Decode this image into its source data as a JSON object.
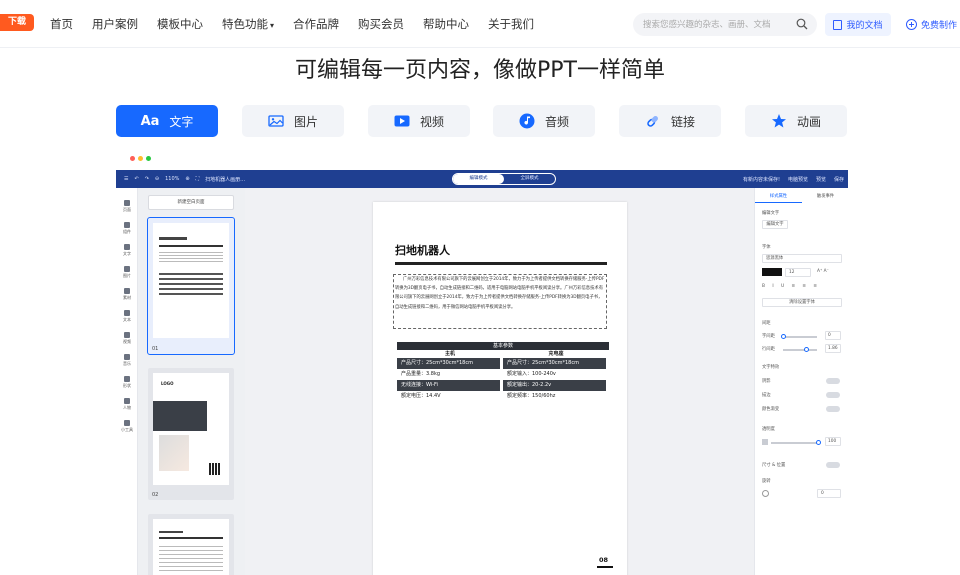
{
  "nav": {
    "app_badge": "下载App",
    "links": [
      "首页",
      "用户案例",
      "模板中心",
      "特色功能",
      "合作品牌",
      "购买会员",
      "帮助中心",
      "关于我们"
    ],
    "search_placeholder": "搜索您感兴趣的杂志、画册、文档",
    "my_docs": "我的文档",
    "free_create": "免费制作"
  },
  "headline": "可编辑每一页内容，像做PPT一样简单",
  "feature_tabs": [
    {
      "icon": "Aa",
      "label": "文字",
      "active": true
    },
    {
      "icon": "image-icon",
      "label": "图片"
    },
    {
      "icon": "video-icon",
      "label": "视频"
    },
    {
      "icon": "audio-icon",
      "label": "音频"
    },
    {
      "icon": "link-icon",
      "label": "链接"
    },
    {
      "icon": "star-icon",
      "label": "动画"
    }
  ],
  "editor": {
    "zoom": "110%",
    "doc_title": "扫地机器人画册…",
    "mode_left": "编辑模式",
    "mode_right": "全屏模式",
    "toolbar_right": [
      "有新内容未保存!",
      "电脑预览",
      "预览",
      "保存"
    ],
    "rail": [
      "页面",
      "组件",
      "文字",
      "图片",
      "素材",
      "文本",
      "视频",
      "音乐",
      "形状",
      "人物",
      "小工具"
    ],
    "new_page": "新建空白页面",
    "thumb_numbers": [
      "01",
      "02"
    ],
    "thumb_logo": "LOGO",
    "paper": {
      "title": "扫地机器人",
      "paragraph": "广州万彩信息技术有限公司旗下的云展网创立于2014年，致力于为上传者提供文档转换存储服务-上传PDF转换为3D翻页电子书，自动生成链接和二维码，适用于电脑网站电脑手机平板阅读分享。广州万彩信息技术有限公司旗下的云展网创立于2014年，致力于为上传者提供文档转换存储服务-上传PDF转换为3D翻页电子书，自动生成链接和二维码，用于微信网站电脑手机平板阅读分享。",
      "table_title": "基本参数",
      "col_left": "主机",
      "col_right": "充电座",
      "rows": [
        [
          "产品尺寸：25cm*30cm*18cm",
          "产品尺寸：25cm*30cm*18cm"
        ],
        [
          "产品重量：3.8kg",
          "额定输入：100-240v"
        ],
        [
          "无线连接：Wi-Fi",
          "额定输出：20-2.2v"
        ],
        [
          "额定电压：14.4V",
          "额定频率：150/60hz"
        ]
      ],
      "page_number": "08"
    },
    "right_panel": {
      "tabs": [
        "样式属性",
        "触发事件"
      ],
      "edit_text": "编辑文字",
      "edit_text_btn": "编辑文字",
      "font": "字体",
      "font_value": "思源黑体",
      "font_size": "12",
      "clear_style": "清除设置字体",
      "spacing": "间距",
      "letter_spacing": "字间距",
      "letter_spacing_value": "0",
      "line_height": "行间距",
      "line_height_value": "1.86",
      "text_effects": "文字特效",
      "shadow": "阴影",
      "stroke": "描边",
      "gradient": "颜色渐变",
      "opacity": "透明度",
      "opacity_value": "100",
      "size_pos": "尺寸 & 位置",
      "rotate": "旋转",
      "rotate_value": "0"
    }
  }
}
